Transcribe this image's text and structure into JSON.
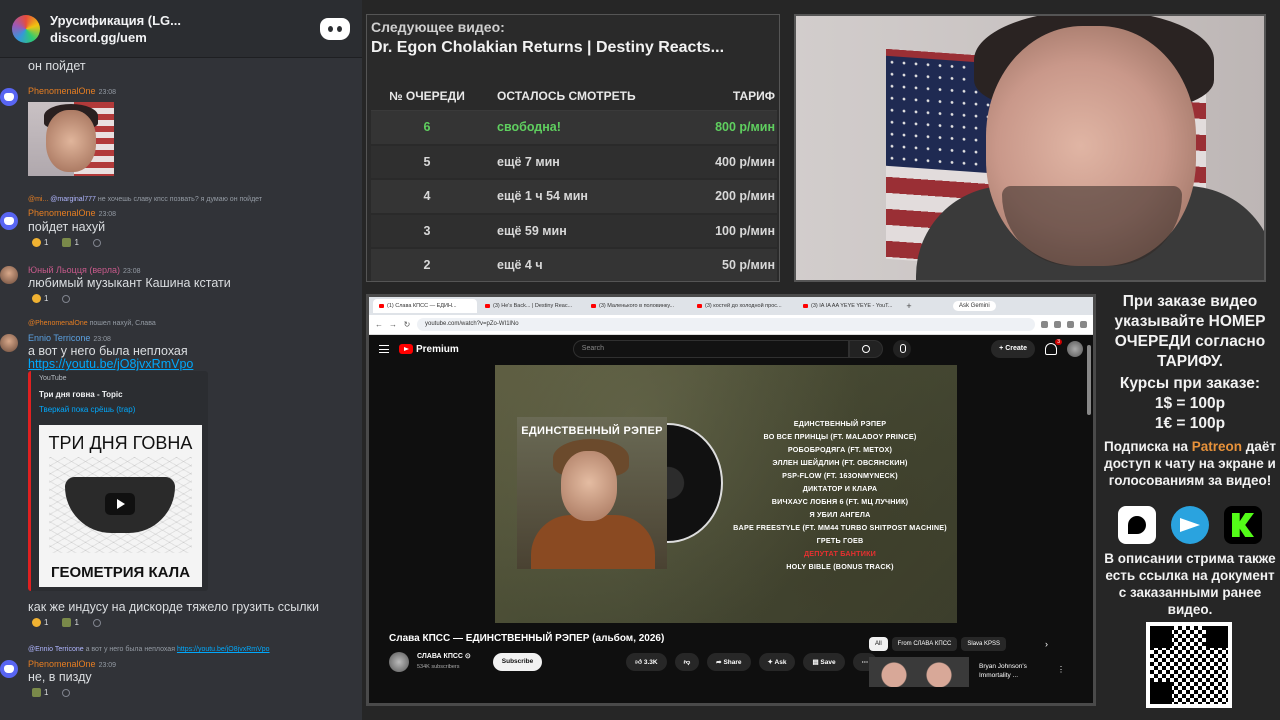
{
  "discord": {
    "server_name": "Урусификация (LG...",
    "invite": "discord.gg/uem",
    "messages": [
      {
        "text": "он пойдет"
      },
      {
        "user": "PhenomenalOne",
        "time": "23:08"
      },
      {
        "reply_user": "@mi...",
        "reply_handle": "@marginal777",
        "reply_text": "не хочешь славу кпсс позвать? я думаю он пойдет",
        "user": "PhenomenalOne",
        "time": "23:08",
        "text": "пойдет нахуй",
        "reactions": [
          "1",
          "1"
        ]
      },
      {
        "user": "Юный Льоцця (верла)",
        "time": "23:08",
        "text": "любимый музыкант Кашина кстати",
        "reactions": [
          "1"
        ]
      },
      {
        "reply_user": "@PhenomenalOne",
        "reply_text": "пошел нахуй, Слава",
        "user": "Ennio Terricone",
        "time": "23:08",
        "text": "а вот у него была неплохая",
        "link": "https://youtu.be/jO8jvxRmVpo"
      },
      {
        "text": "как же индусу на дискорде тяжело грузить ссылки",
        "reactions": [
          "1",
          "1"
        ]
      },
      {
        "reply_user": "@Ennio Terricone",
        "reply_text": "а вот у него была неплохая",
        "reply_link": "https://youtu.be/jO8jvxRmVpo",
        "user": "PhenomenalOne",
        "time": "23:09",
        "text": "не, в пизду",
        "reactions": [
          "1"
        ]
      }
    ],
    "embed": {
      "source": "YouTube",
      "title": "Три дня говна - Topic",
      "author": "Тверкай пока срёшь (trap)",
      "thumb_top": "ТРИ ДНЯ ГОВНА",
      "thumb_bottom": "ГЕОМЕТРИЯ КАЛА"
    }
  },
  "queue": {
    "next_label": "Следующее видео:",
    "next_title": "Dr. Egon Cholakian Returns | Destiny Reacts...",
    "headers": [
      "№ ОЧЕРЕДИ",
      "ОСТАЛОСЬ СМОТРЕТЬ",
      "ТАРИФ"
    ],
    "rows": [
      [
        "6",
        "свободна!",
        "800 р/мин"
      ],
      [
        "5",
        "ещё 7 мин",
        "400 р/мин"
      ],
      [
        "4",
        "ещё 1 ч 54 мин",
        "200 р/мин"
      ],
      [
        "3",
        "ещё 59 мин",
        "100 р/мин"
      ],
      [
        "2",
        "ещё 4 ч",
        "50 р/мин"
      ]
    ],
    "first_row_color": "#5fcf5f"
  },
  "browser": {
    "tabs": [
      "(1) Слава КПСС — ЕДИН...",
      "(3) He's Back... | Destiny Reac...",
      "(3) Маленького в половинку...",
      "(3) костей до холодной прос...",
      "(3) IA IA AA YEYE YEYE - YouT..."
    ],
    "gemini": "Ask Gemini",
    "url": "youtube.com/watch?v=pZo-WI1lNo",
    "yt_brand": "Premium",
    "search_placeholder": "Search",
    "create": "Create",
    "notif_count": "3",
    "album_title": "ЕДИНСТВЕННЫЙ РЭПЕР",
    "tracks": [
      "ЕДИНСТВЕННЫЙ РЭПЕР",
      "ВО ВСЕ ПРИНЦЫ (FT. MALADOY PRINCE)",
      "РОБОБРОДЯГА (FT. METOX)",
      "ЭЛЛЕН ШЕЙДЛИН (FT. ОВСЯНСКИН)",
      "PSP-FLOW (FT. 163ONMYNECK)",
      "ДИКТАТОР И КЛАРА",
      "ВИЧХАУС ЛОБНЯ 6 (FT. МЦ ЛУЧНИК)",
      "Я УБИЛ АНГЕЛА",
      "BAPE FREESTYLE (FT. MM44 TURBO SHITPOST MACHINE)",
      "ГРЕТЬ ГОЕВ",
      "ДЕПУТАТ БАНТИКИ",
      "HOLY BIBLE (BONUS TRACK)"
    ],
    "highlight_track_index": 10,
    "highlight_color": "#e63030",
    "video_title": "Слава КПСС — ЕДИНСТВЕННЫЙ РЭПЕР (альбом, 2026)",
    "channel": "СЛАВА КПСС ⊙",
    "subs": "534K subscribers",
    "subscribe": "Subscribe",
    "likes": "3.3K",
    "share": "Share",
    "ask": "Ask",
    "save": "Save",
    "chips": [
      "All",
      "From СЛАВА КПСС",
      "Slava KPSS"
    ],
    "rec_title_1": "Bryan Johnson's",
    "rec_title_2": "Immortality ..."
  },
  "info": {
    "order": "При заказе видео указывайте НОМЕР ОЧЕРЕДИ согласно ТАРИФУ.",
    "rates_title": "Курсы при заказе:",
    "rate_usd": "1$ = 100р",
    "rate_eur": "1€ = 100р",
    "sub_pre": "Подписка на",
    "sub_brand": "Patreon",
    "sub_post": "даёт доступ к чату на экране и голосованиям за видео!",
    "doc": "В описании стрима также есть ссылка на документ с заказанными ранее видео.",
    "accent": "#e8923a"
  }
}
